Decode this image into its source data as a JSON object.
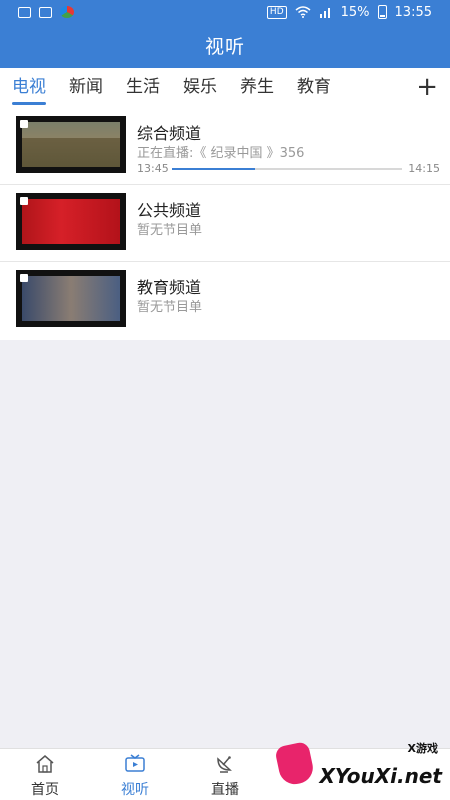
{
  "statusbar": {
    "battery": "15%",
    "time": "13:55",
    "hd": "HD"
  },
  "header": {
    "title": "视听"
  },
  "tabs": [
    {
      "label": "电视",
      "active": true
    },
    {
      "label": "新闻",
      "active": false
    },
    {
      "label": "生活",
      "active": false
    },
    {
      "label": "娱乐",
      "active": false
    },
    {
      "label": "养生",
      "active": false
    },
    {
      "label": "教育",
      "active": false
    }
  ],
  "tabs_add": "+",
  "channels": [
    {
      "name": "综合频道",
      "sub": "正在直播:《 纪录中国 》356",
      "start": "13:45",
      "end": "14:15",
      "progress": 0.36
    },
    {
      "name": "公共频道",
      "sub": "暂无节目单"
    },
    {
      "name": "教育频道",
      "sub": "暂无节目单"
    }
  ],
  "bottom_nav": [
    {
      "label": "首页",
      "icon": "home-icon",
      "active": false
    },
    {
      "label": "视听",
      "icon": "tv-icon",
      "active": true
    },
    {
      "label": "直播",
      "icon": "satellite-dish-icon",
      "active": false
    }
  ],
  "watermark": {
    "text": "XYouXi.net",
    "sub": "X游戏"
  },
  "colors": {
    "accent": "#3b7fd4",
    "background": "#efeff4"
  }
}
